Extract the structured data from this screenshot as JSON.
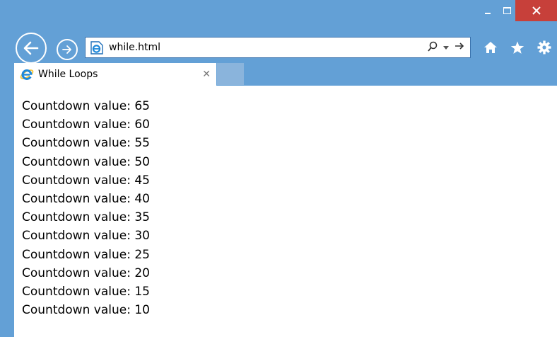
{
  "window": {
    "controls": [
      "minimize",
      "maximize",
      "close"
    ]
  },
  "nav": {
    "back_icon": "back-arrow-icon",
    "forward_icon": "forward-arrow-icon"
  },
  "addressbar": {
    "url": "while.html",
    "page_icon": "ie-page-icon",
    "search_icon": "search-icon",
    "dropdown_icon": "chevron-down-icon",
    "go_icon": "go-arrow-icon"
  },
  "toolbar": {
    "icons": [
      "home-icon",
      "favorites-star-icon",
      "settings-gear-icon"
    ]
  },
  "tab": {
    "label": "While Loops",
    "icon": "ie-logo-icon"
  },
  "content": {
    "lines": [
      "Countdown value: 65",
      "Countdown value: 60",
      "Countdown value: 55",
      "Countdown value: 50",
      "Countdown value: 45",
      "Countdown value: 40",
      "Countdown value: 35",
      "Countdown value: 30",
      "Countdown value: 25",
      "Countdown value: 20",
      "Countdown value: 15",
      "Countdown value: 10"
    ]
  },
  "colors": {
    "frame": "#63a0d6",
    "close_button": "#c7403a",
    "ie_blue": "#1e88d9",
    "ie_ring": "#f7c638"
  }
}
